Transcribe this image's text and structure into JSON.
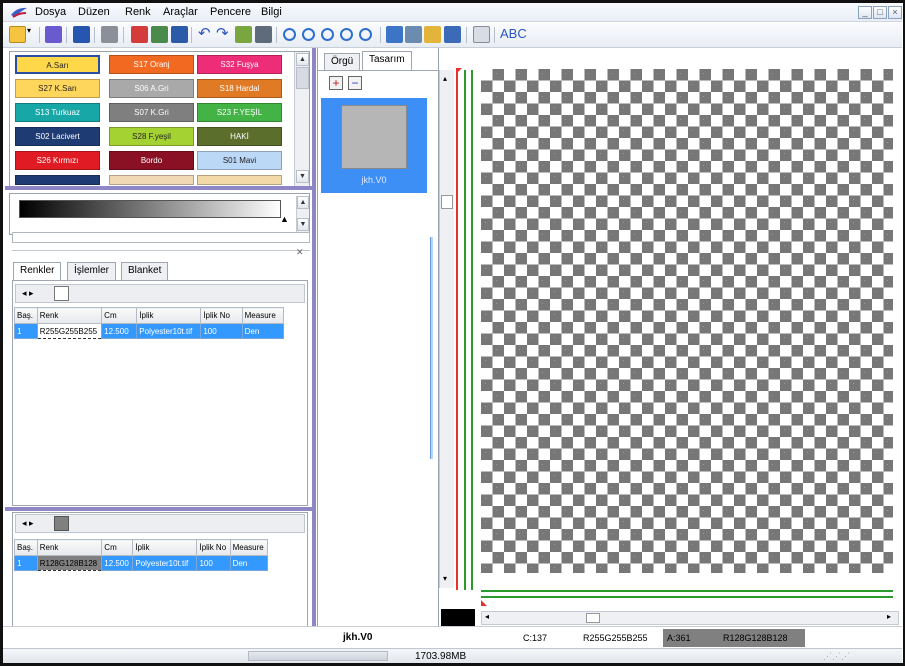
{
  "menu": [
    "Dosya",
    "Düzen",
    "Renk",
    "Araçlar",
    "Pencere",
    "Bilgi"
  ],
  "window_controls": [
    "_",
    "□",
    "×"
  ],
  "palette": [
    {
      "label": "A.Sarı",
      "color": "#ffd84a",
      "text": "#222"
    },
    {
      "label": "S17 Oranj",
      "color": "#f26a21",
      "text": "#fff"
    },
    {
      "label": "S32 Fuşya",
      "color": "#ee2d78",
      "text": "#fff"
    },
    {
      "label": "S27 K.Sarı",
      "color": "#ffd65c",
      "text": "#222"
    },
    {
      "label": "S06 A.Gri",
      "color": "#a9a9a9",
      "text": "#fff"
    },
    {
      "label": "S18 Hardal",
      "color": "#e07a24",
      "text": "#fff"
    },
    {
      "label": "S13 Turkuaz",
      "color": "#18a7a7",
      "text": "#fff"
    },
    {
      "label": "S07 K.Gri",
      "color": "#7f7f7f",
      "text": "#fff"
    },
    {
      "label": "S23 F.YEŞİL",
      "color": "#44b346",
      "text": "#fff"
    },
    {
      "label": "S02 Lacivert",
      "color": "#1f3b74",
      "text": "#fff"
    },
    {
      "label": "S28 F.yeşil",
      "color": "#a4d233",
      "text": "#222"
    },
    {
      "label": "HAKİ",
      "color": "#5b6e2b",
      "text": "#fff"
    },
    {
      "label": "S26 Kırmızı",
      "color": "#e01b24",
      "text": "#fff"
    },
    {
      "label": "Bordo",
      "color": "#8a1024",
      "text": "#fff"
    },
    {
      "label": "S01 Mavi",
      "color": "#bcd8f7",
      "text": "#222"
    }
  ],
  "tabs_left": [
    "Renkler",
    "İşlemler",
    "Blanket"
  ],
  "table1": {
    "headers": [
      "Baş.",
      "Renk",
      "Cm",
      "İplik",
      "İplik No",
      "Measure"
    ],
    "rows": [
      [
        "1",
        "R255G255B255",
        "12.500",
        "Polyester10t.tif",
        "100",
        "Den"
      ]
    ]
  },
  "table2": {
    "headers": [
      "Baş.",
      "Renk",
      "Cm",
      "İplik",
      "İplik No",
      "Measure"
    ],
    "rows": [
      [
        "1",
        "R128G128B128",
        "12.500",
        "Polyester10t.tif",
        "100",
        "Den"
      ]
    ]
  },
  "tabs_center": [
    "Örgü",
    "Tasarım"
  ],
  "thumbnail_label": "jkh.V0",
  "status": {
    "name": "jkh.V0",
    "c": "C:137",
    "color1": "R255G255B255",
    "a": "A:361",
    "color2": "R128G128B128"
  },
  "memory": "1703.98MB",
  "colors": {
    "selection": "#3399ff",
    "divider": "#8f86c6",
    "checker": "#777777",
    "guide_green": "#2a9b2a"
  }
}
